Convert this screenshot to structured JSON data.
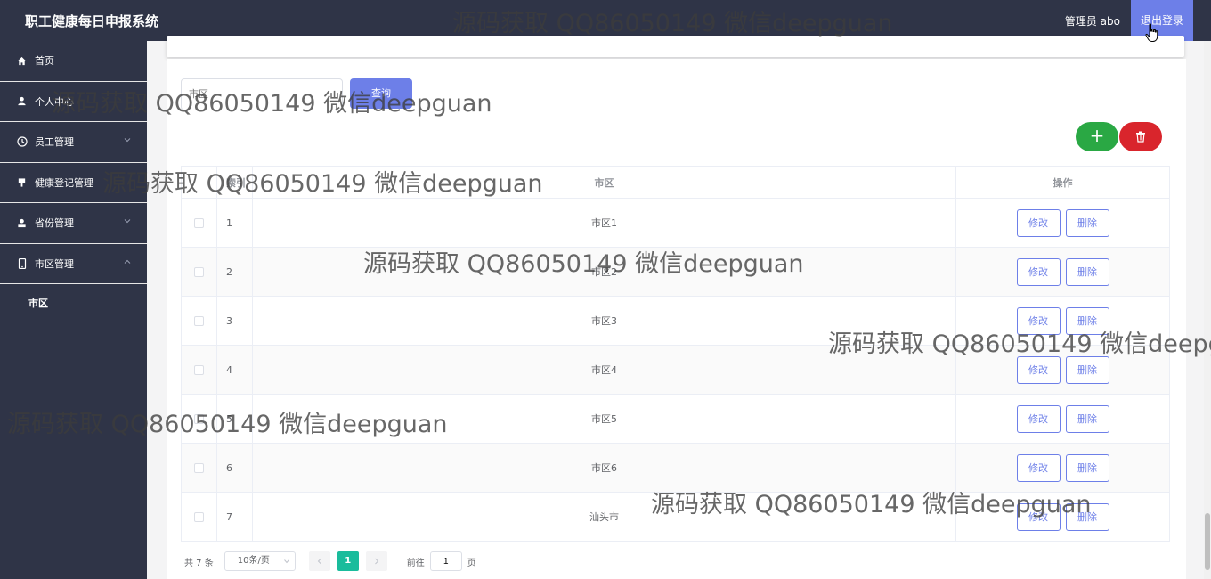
{
  "header": {
    "app_title": "职工健康每日申报系统",
    "admin_label": "管理员 abo",
    "logout_label": "退出登录"
  },
  "sidebar": {
    "items": [
      {
        "label": "首页",
        "icon": "home-icon"
      },
      {
        "label": "个人中心",
        "icon": "user-icon"
      },
      {
        "label": "员工管理",
        "icon": "clock-icon"
      },
      {
        "label": "健康登记管理",
        "icon": "pin-icon"
      },
      {
        "label": "省份管理",
        "icon": "person-icon"
      },
      {
        "label": "市区管理",
        "icon": "phone-icon"
      }
    ],
    "subitems": [
      {
        "label": "市区"
      }
    ]
  },
  "toolbar": {
    "search_placeholder": "市区",
    "search_label": "查询"
  },
  "table": {
    "headers": {
      "index": "索引",
      "city": "市区",
      "ops": "操作"
    },
    "edit_label": "修改",
    "delete_label": "删除",
    "rows": [
      {
        "index": "1",
        "city": "市区1"
      },
      {
        "index": "2",
        "city": "市区2"
      },
      {
        "index": "3",
        "city": "市区3"
      },
      {
        "index": "4",
        "city": "市区4"
      },
      {
        "index": "5",
        "city": "市区5"
      },
      {
        "index": "6",
        "city": "市区6"
      },
      {
        "index": "7",
        "city": "汕头市"
      }
    ]
  },
  "pagination": {
    "total": "共 7 条",
    "page_size": "10条/页",
    "current_page": "1",
    "goto_prefix": "前往",
    "goto_value": "1",
    "goto_suffix": "页"
  },
  "watermark_text": "源码获取 QQ86050149 微信deepguan",
  "colors": {
    "sidebar_bg": "#2f3447",
    "accent": "#6d7fe8",
    "add": "#2aa844",
    "delete": "#d9252c",
    "page_active": "#1abc9c"
  }
}
